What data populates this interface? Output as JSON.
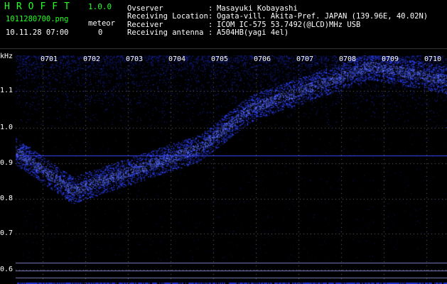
{
  "app": {
    "title": "HROFFT",
    "version": "1.0.0"
  },
  "file": {
    "name": "1011280700.png",
    "datetime": "10.11.28 07:00"
  },
  "meteor": {
    "label": "meteor",
    "count": "0"
  },
  "info": [
    {
      "key": "Ovserver",
      "sep": ":",
      "value": "Masayuki Kobayashi"
    },
    {
      "key": "Receiving Location",
      "sep": ":",
      "value": "Ogata-vill. Akita-Pref. JAPAN (139.96E, 40.02N)"
    },
    {
      "key": "Receiver",
      "sep": ":",
      "value": "ICOM IC-575 53.7492(@LCD)MHz USB"
    },
    {
      "key": "Receiving antenna",
      "sep": ":",
      "value": "A504HB(yagi 4el)"
    }
  ],
  "spectrogram": {
    "unit": "kHz",
    "y_ticks": [
      "1.1",
      "1.0",
      "0.9",
      "0.8",
      "0.7",
      "0.6"
    ],
    "time_ticks": [
      "0701",
      "0702",
      "0703",
      "0704",
      "0705",
      "0706",
      "0707",
      "0708",
      "0709",
      "0710"
    ],
    "colors": {
      "text": "#ffffff",
      "green": "#22ff22",
      "signal": "#2a3cff",
      "reference_line": "#3a48ff"
    }
  }
}
